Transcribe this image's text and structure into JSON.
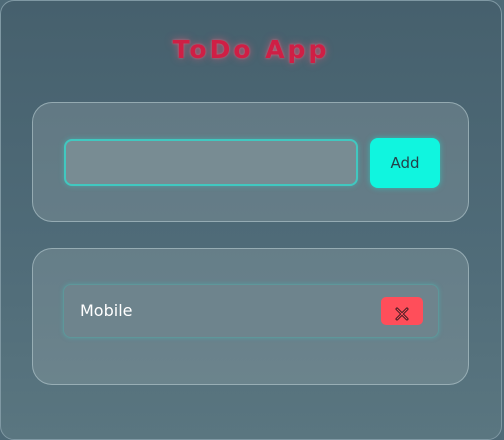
{
  "app": {
    "title": "ToDo App"
  },
  "form": {
    "input_value": "",
    "input_placeholder": "",
    "add_label": "Add"
  },
  "todos": [
    {
      "text": "Mobile",
      "delete_icon": "close-icon"
    }
  ],
  "colors": {
    "title": "#cf1f45",
    "accent": "#10f5df",
    "delete": "#ff4e5a",
    "input_border": "#41c8c0"
  }
}
